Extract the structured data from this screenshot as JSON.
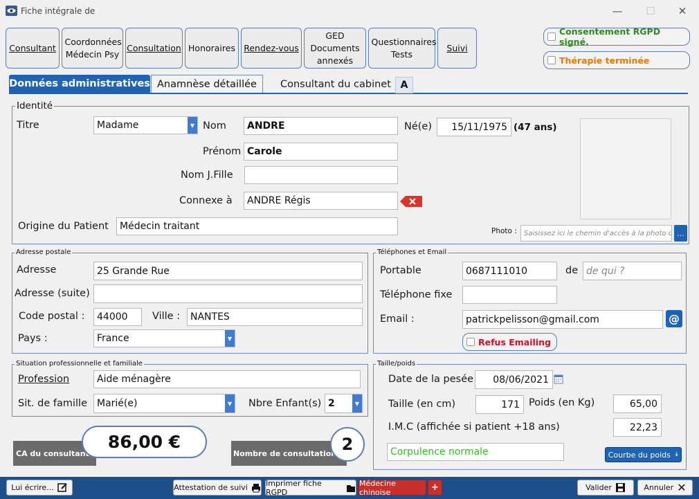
{
  "window": {
    "title": "Fiche intégrale de",
    "icons": [
      "app-eye-icon",
      "minimize-icon",
      "maximize-icon",
      "close-icon"
    ]
  },
  "tabs_top": [
    {
      "label": "Consultant"
    },
    {
      "label": "Coordonnées Médecin Psy"
    },
    {
      "label": "Consultation"
    },
    {
      "label": "Honoraires"
    },
    {
      "label": "Rendez-vous"
    },
    {
      "label": "GED Documents annexés"
    },
    {
      "label": "Questionnaires Tests"
    },
    {
      "label": "Suivi"
    }
  ],
  "checks": {
    "rgpd": "Consentement RGPD signé.",
    "therapie": "Thérapie terminée",
    "rgpd_color": "#2e8b1e",
    "therapie_color": "#e87a00"
  },
  "subtabs": {
    "admin": "Données administratives",
    "anamnese": "Anamnèse détaillée",
    "cabinet": "Consultant du cabinet",
    "cabinet_letter": "A"
  },
  "identite": {
    "legend": "Identité",
    "titre_label": "Titre",
    "titre_value": "Madame",
    "nom_label": "Nom",
    "nom_value": "ANDRE",
    "ne_label": "Né(e)",
    "ne_value": "15/11/1975",
    "age": "(47 ans)",
    "prenom_label": "Prénom",
    "prenom_value": "Carole",
    "nomjf_label": "Nom J.Fille",
    "nomjf_value": "",
    "connexe_label": "Connexe à",
    "connexe_value": "ANDRE Régis",
    "origine_label": "Origine du Patient",
    "origine_value": "Médecin traitant",
    "photo_label": "Photo :",
    "photo_placeholder": "Saisissez ici le chemin d'accès à la photo du",
    "photo_btn": "..."
  },
  "adresse": {
    "legend": "Adresse postale",
    "adresse_label": "Adresse",
    "adresse_value": "25 Grande Rue",
    "suite_label": "Adresse (suite)",
    "suite_value": "",
    "cp_label": "Code postal :",
    "cp_value": "44000",
    "ville_label": "Ville :",
    "ville_value": "NANTES",
    "pays_label": "Pays :",
    "pays_value": "France"
  },
  "telephones": {
    "legend": "Téléphones et Email",
    "portable_label": "Portable",
    "portable_value": "0687111010",
    "de_label": "de",
    "de_placeholder": "de qui ?",
    "fixe_label": "Téléphone fixe",
    "fixe_value": "",
    "email_label": "Email :",
    "email_value": "patrickpelisson@gmail.com",
    "refus": "Refus Emailing",
    "refus_color": "#c8102e"
  },
  "situation": {
    "legend": "Situation professionnelle et familiale",
    "profession_label": "Profession",
    "profession_value": "Aide ménagère",
    "sit_label": "Sit. de famille",
    "sit_value": "Marié(e)",
    "enfants_label": "Nbre Enfant(s)",
    "enfants_value": "2"
  },
  "taille": {
    "legend": "Taille/poids",
    "date_label": "Date de la pesée",
    "date_value": "08/06/2021",
    "taille_label": "Taille (en cm)",
    "taille_value": "171",
    "poids_label": "Poids (en Kg)",
    "poids_value": "65,00",
    "imc_label": "I.M.C (affichée si patient +18 ans)",
    "imc_value": "22,23",
    "corpulence": "Corpulence normale",
    "courbe_btn": "Courbe du poids"
  },
  "stats": {
    "ca_label": "CA du consultant",
    "ca_value": "86,00 €",
    "nb_label": "Nombre de consultations",
    "nb_value": "2"
  },
  "bottom": {
    "ecrire": "Lui écrire...",
    "attestation": "Attestation de suivi",
    "imprimer": "Imprimer fiche RGPD",
    "medecine": "Médecine chinoise",
    "plus": "+",
    "valider": "Valider",
    "annuler": "Annuler"
  }
}
